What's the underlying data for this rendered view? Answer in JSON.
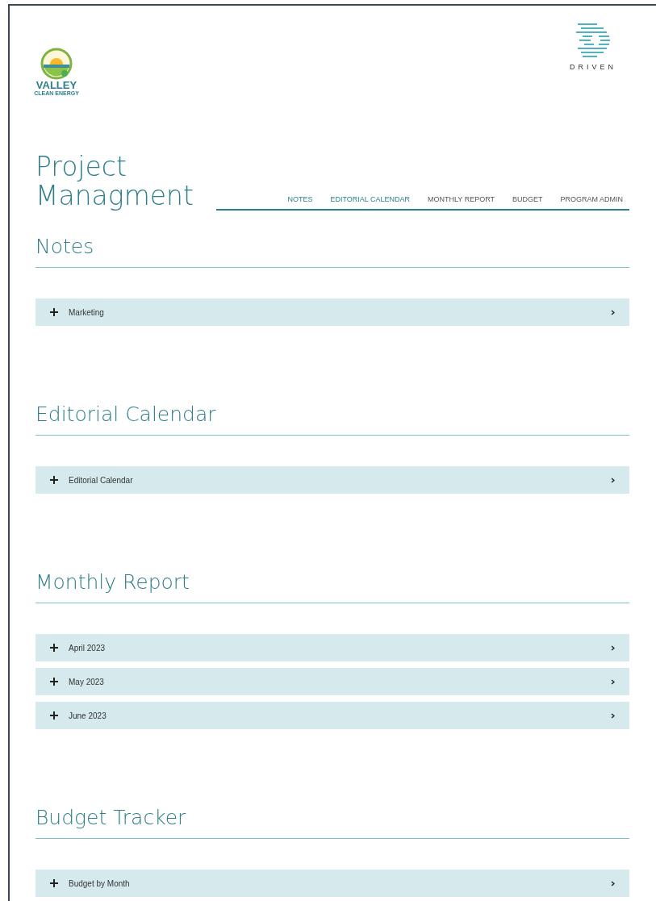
{
  "logos": {
    "left": {
      "name": "VALLEY",
      "tagline": "CLEAN ENERGY"
    },
    "right": {
      "name": "DRIVEN"
    }
  },
  "title": [
    "Project",
    "Managment"
  ],
  "nav": [
    {
      "label": "NOTES",
      "highlighted": true
    },
    {
      "label": "EDITORIAL CALENDAR",
      "highlighted": true
    },
    {
      "label": "MONTHLY REPORT",
      "highlighted": false
    },
    {
      "label": "BUDGET",
      "highlighted": false
    },
    {
      "label": "PROGRAM ADMIN",
      "highlighted": false
    }
  ],
  "sections": [
    {
      "heading": "Notes",
      "items": [
        {
          "label": "Marketing",
          "expanded": false
        }
      ]
    },
    {
      "heading": "Editorial Calendar",
      "items": [
        {
          "label": "Editorial Calendar",
          "expanded": false
        }
      ]
    },
    {
      "heading": "Monthly Report",
      "items": [
        {
          "label": "April 2023",
          "expanded": false
        },
        {
          "label": "May 2023",
          "expanded": false
        },
        {
          "label": "June 2023",
          "expanded": false
        }
      ]
    },
    {
      "heading": "Budget Tracker",
      "items": [
        {
          "label": "Budget by Month",
          "expanded": false
        }
      ]
    }
  ]
}
